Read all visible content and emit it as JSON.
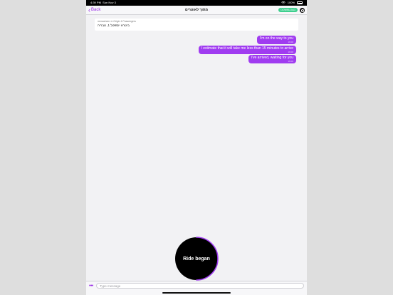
{
  "status_bar": {
    "time": "4:39 PM",
    "date": "Sun Nov 3",
    "wifi": "wifi-icon",
    "battery_pct": "100%"
  },
  "nav": {
    "back_label": "Back",
    "title": "מתוך לאוטרים",
    "badge": "DOWNLOAD"
  },
  "ride_info": {
    "meta": "menachem ➡ Origin 1 Passengers",
    "address": "ביטרא יוספטל 1, טבריה"
  },
  "messages": [
    {
      "text": "I'm on the way to you",
      "time": "16:00"
    },
    {
      "text": "I estimate that it will take me less than 15 minutes to arrive",
      "time": "16:00"
    },
    {
      "text": "I've arrived, waiting for you",
      "time": "16:00"
    }
  ],
  "ride_button": {
    "label": "Ride began",
    "progress": 0.5
  },
  "composer": {
    "more_icon": "more-dots-icon",
    "placeholder": "Type message"
  },
  "colors": {
    "accent": "#a03cf0",
    "badge": "#3ecf8e",
    "ride_bg": "#000000"
  }
}
